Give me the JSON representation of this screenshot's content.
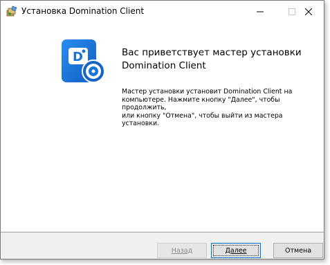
{
  "window": {
    "title": "Установка Domination Client"
  },
  "caption": {
    "minimize_icon": "minimize-icon",
    "maximize_icon": "maximize-icon",
    "close_icon": "close-icon"
  },
  "welcome": {
    "heading_line1": "Вас приветствует мастер установки",
    "heading_line2": "Domination Client",
    "description_line1": "Мастер установки установит Domination Client на",
    "description_line2": "компьютере. Нажмите кнопку \"Далее\", чтобы продолжить,",
    "description_line3": "или кнопку \"Отмена\", чтобы выйти из мастера установки."
  },
  "buttons": {
    "back": "Назад",
    "next": "Далее",
    "cancel": "Отмена"
  },
  "colors": {
    "accent": "#1a73d6",
    "button_face": "#e1e1e1",
    "footer": "#f0f0f0"
  }
}
